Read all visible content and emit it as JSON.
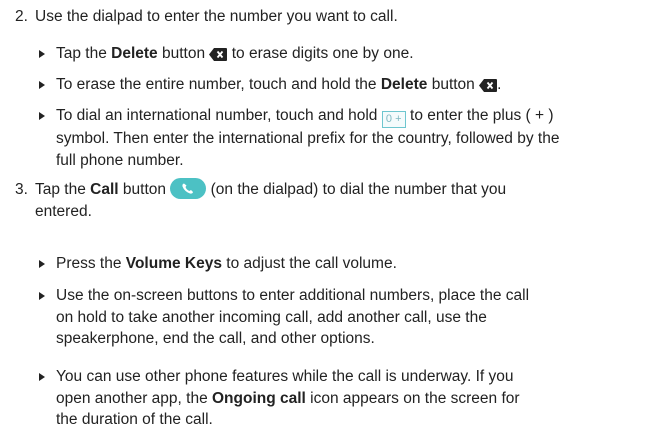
{
  "step2": {
    "number": "2.",
    "text": "Use the dialpad to enter the number you want to call."
  },
  "bullet_delete": {
    "pre": "Tap the ",
    "bold": "Delete",
    "mid": " button ",
    "post": " to erase digits one by one."
  },
  "bullet_erase_all": {
    "pre": "To erase the entire number, touch and hold the ",
    "bold": "Delete",
    "mid": " button ",
    "post": "."
  },
  "bullet_international": {
    "line1_pre": "To dial an international number, touch and hold ",
    "key_label": "0 +",
    "line1_post": " to enter the plus ( + )",
    "line2": "symbol. Then enter the international prefix for the country, followed by the",
    "line3": "full phone number."
  },
  "step3": {
    "number": "3.",
    "line1_pre": "Tap the ",
    "bold": "Call",
    "line1_mid": " button ",
    "line1_post": " (on the dialpad) to dial the number that you",
    "line2": "entered."
  },
  "bullet_volume": {
    "pre": "Press the ",
    "bold": "Volume Keys",
    "post": " to adjust the call volume."
  },
  "bullet_onscreen": {
    "line1": "Use the on-screen buttons to enter additional numbers, place the call",
    "line2": "on hold to take another incoming call, add another call, use the",
    "line3": "speakerphone, end the call, and other options."
  },
  "bullet_ongoing": {
    "line1": "You can use other phone features while the call is underway. If you",
    "line2_pre": "open another app, the ",
    "line2_bold": "Ongoing call",
    "line2_post": " icon appears on the screen for",
    "line3": "the duration of the call."
  },
  "icons": {
    "delete": "backspace-delete-icon",
    "call": "phone-call-icon",
    "bullet": "triangle-bullet-icon"
  },
  "colors": {
    "call_button": "#4cc1c4",
    "key_border": "#6ec6cf"
  }
}
